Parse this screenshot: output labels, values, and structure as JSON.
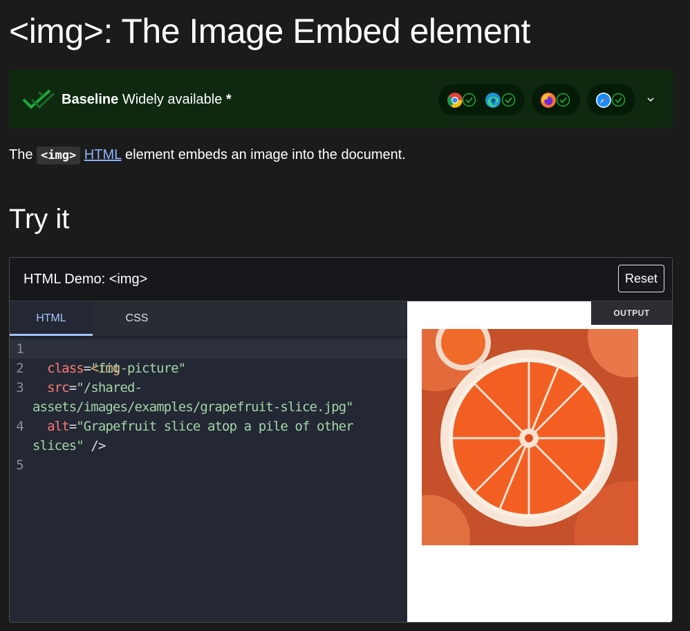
{
  "page": {
    "title": "<img>: The Image Embed element"
  },
  "baseline": {
    "label_bold": "Baseline",
    "label_status": "Widely available",
    "asterisk": "*",
    "browsers": [
      "chrome",
      "edge",
      "firefox",
      "safari"
    ],
    "colors": {
      "banner_bg": "#0e2910",
      "pill_bg": "#051b07",
      "check": "#1fa936"
    }
  },
  "intro": {
    "lead": "The",
    "code": "<img>",
    "link": "HTML",
    "rest": "element embeds an image into the document."
  },
  "section": {
    "heading": "Try it"
  },
  "demo": {
    "title": "HTML Demo: <img>",
    "reset_label": "Reset",
    "tabs": [
      {
        "label": "HTML",
        "active": true
      },
      {
        "label": "CSS",
        "active": false
      }
    ],
    "output_label": "OUTPUT",
    "code": {
      "line_numbers": [
        "1",
        "2",
        "3",
        "4",
        "5"
      ],
      "l1_tag": "<img",
      "l2_attr": "class",
      "l2_eq": "=",
      "l2_val": "\"fit-picture\"",
      "l3_attr": "src",
      "l3_eq": "=",
      "l3_val_a": "\"/shared-",
      "l3_val_b": "assets/images/examples/grapefruit-slice.jpg\"",
      "l4_attr": "alt",
      "l4_eq": "=",
      "l4_val_a": "\"Grapefruit slice atop a pile of other",
      "l4_val_b": "slices\"",
      "l4_close": " />"
    },
    "image_alt": "Grapefruit slice atop a pile of other slices"
  }
}
